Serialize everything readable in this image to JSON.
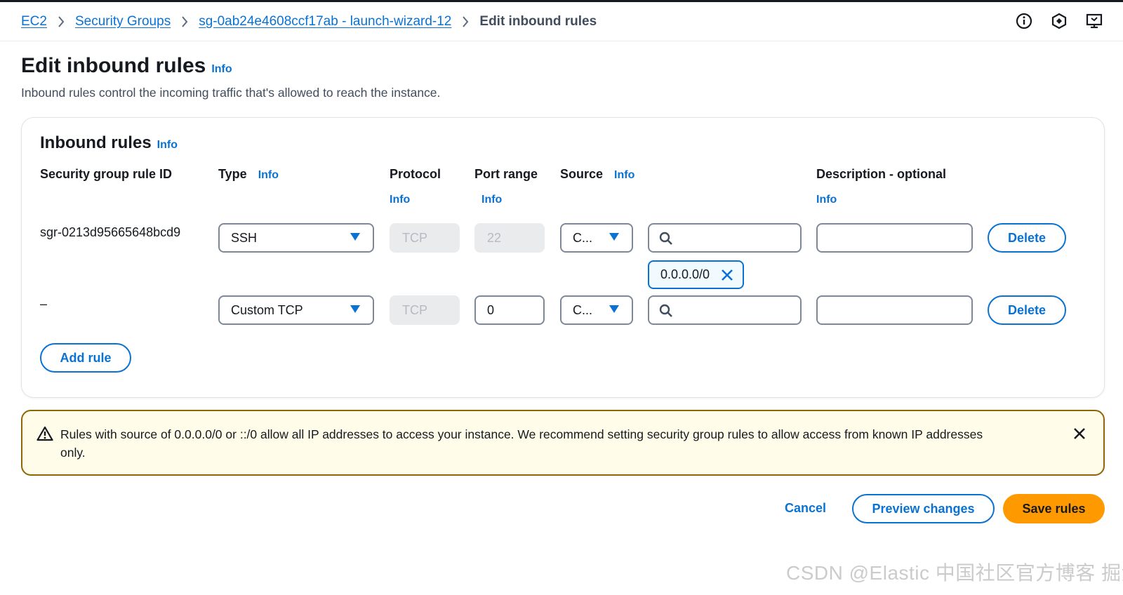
{
  "breadcrumb": {
    "items": [
      "EC2",
      "Security Groups",
      "sg-0ab24e4608ccf17ab - launch-wizard-12"
    ],
    "current": "Edit inbound rules"
  },
  "top_icons": [
    "info-circle-icon",
    "hexagon-settings-icon",
    "feedback-icon"
  ],
  "header": {
    "title": "Edit inbound rules",
    "info": "Info",
    "description": "Inbound rules control the incoming traffic that's allowed to reach the instance."
  },
  "inbound_rules": {
    "title": "Inbound rules",
    "info": "Info",
    "columns": {
      "rule_id": "Security group rule ID",
      "type": "Type",
      "type_info": "Info",
      "protocol": "Protocol",
      "protocol_info": "Info",
      "port_range": "Port range",
      "port_range_info": "Info",
      "source": "Source",
      "source_info": "Info",
      "description": "Description - optional",
      "description_info": "Info"
    },
    "rows": [
      {
        "rule_id": "sgr-0213d95665648bcd9",
        "type": "SSH",
        "protocol": "TCP",
        "port_range": "22",
        "source_type": "C...",
        "source_search": "",
        "source_token": "0.0.0.0/0",
        "description": "",
        "delete_label": "Delete"
      },
      {
        "rule_id": "–",
        "type": "Custom TCP",
        "protocol": "TCP",
        "port_range": "0",
        "source_type": "C...",
        "source_search": "",
        "description": "",
        "delete_label": "Delete"
      }
    ],
    "add_rule_label": "Add rule"
  },
  "warning": {
    "message": "Rules with source of 0.0.0.0/0 or ::/0 allow all IP addresses to access your instance. We recommend setting security group rules to allow access from known IP addresses only."
  },
  "actions": {
    "cancel": "Cancel",
    "preview": "Preview changes",
    "save": "Save rules"
  },
  "watermark": "CSDN @Elastic 中国社区官方博客  掘金技术社区 @ Elasticsearch",
  "colors": {
    "link": "#0972d3",
    "primary_button": "#ff9900",
    "warning_border": "#8d6605",
    "warning_bg": "#fffce9"
  }
}
